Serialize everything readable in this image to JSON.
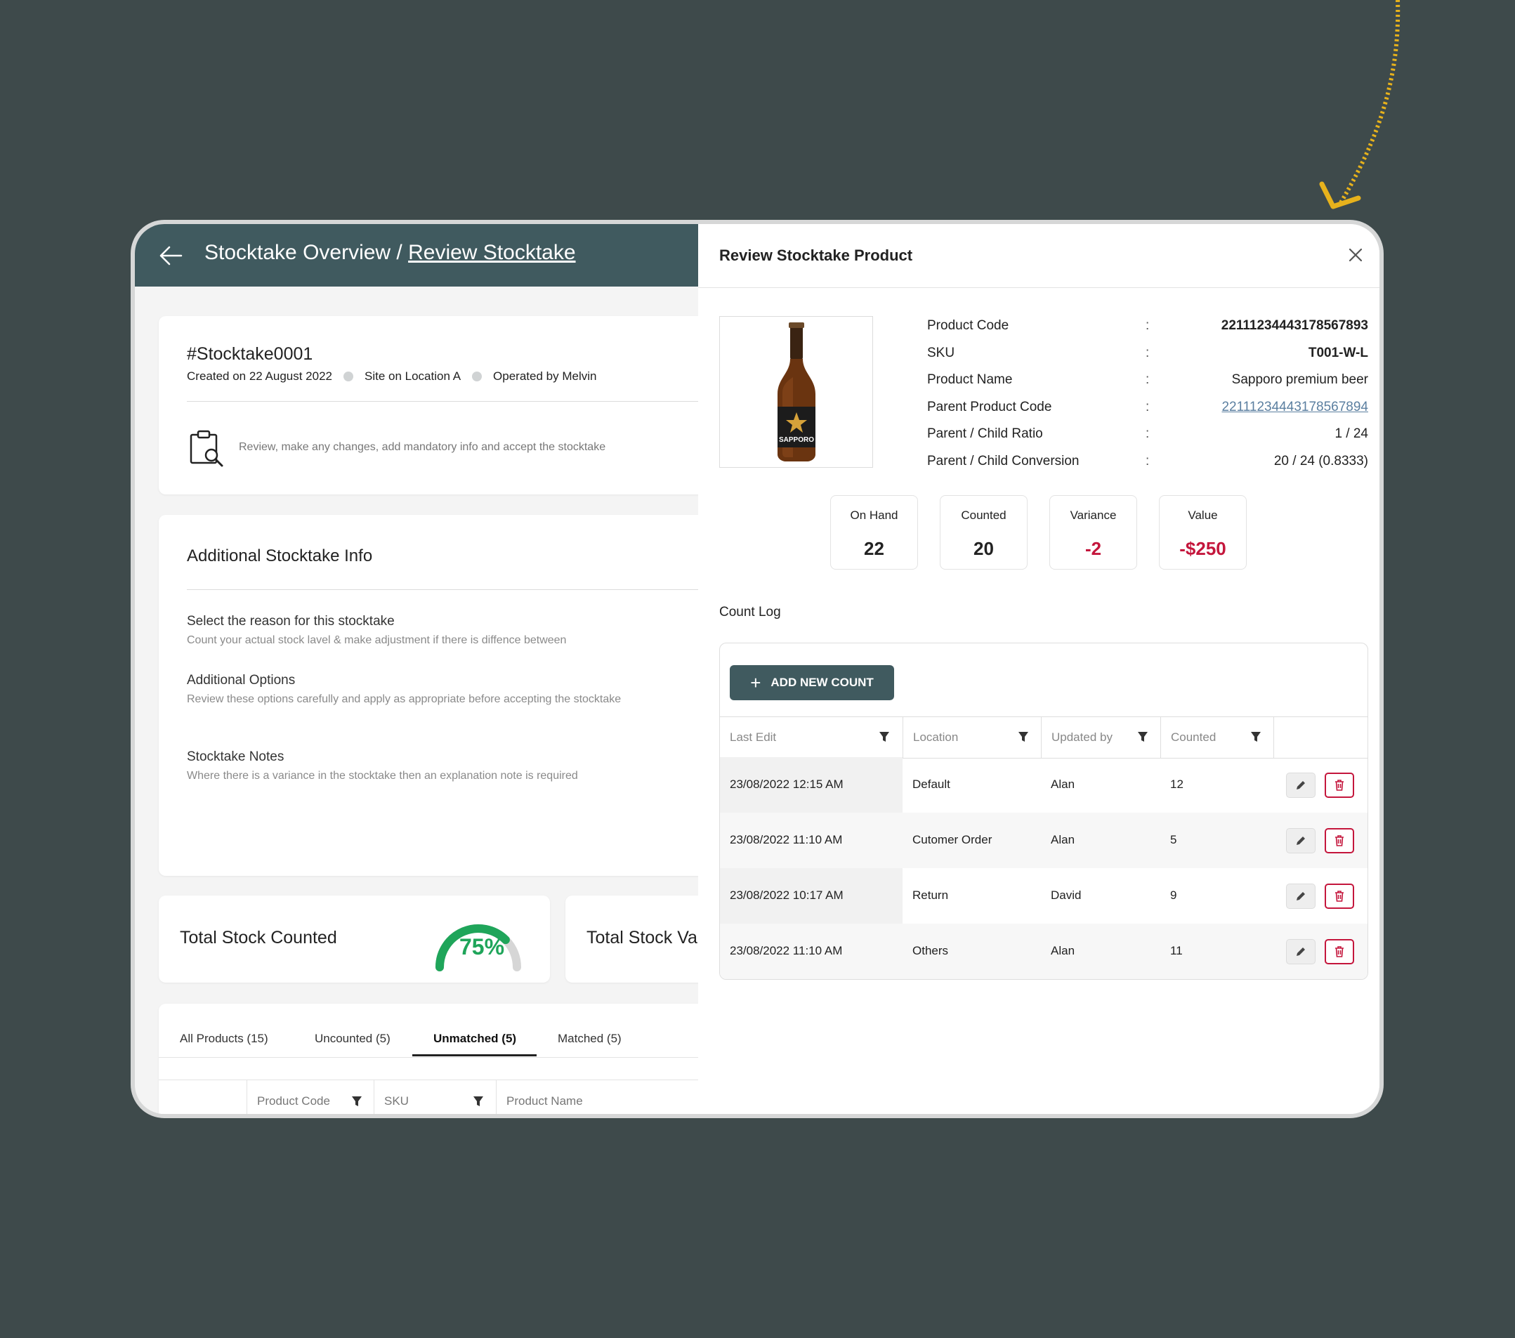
{
  "colors": {
    "background": "#3e4a4b",
    "header": "#405a5f",
    "accent_yellow": "#e7b21c",
    "negative": "#c4163c",
    "gauge_green": "#1fa55a"
  },
  "header": {
    "crumb_root": "Stocktake Overview / ",
    "crumb_current": "Review Stocktake"
  },
  "stocktake": {
    "title": "#Stocktake0001",
    "created": "Created on 22 August 2022",
    "site": "Site on Location A",
    "operator": "Operated by Melvin",
    "hint": "Review, make any changes, add mandatory info and accept the stocktake"
  },
  "additional": {
    "title": "Additional Stocktake Info",
    "reason_title": "Select the reason for this stocktake",
    "reason_desc": "Count your actual stock lavel & make adjustment if there is diffence between",
    "options_title": "Additional Options",
    "options_desc": "Review these options carefully and apply as appropriate before accepting the stocktake",
    "notes_title": "Stocktake Notes",
    "notes_desc": "Where there is a variance in the stocktake then an explanation note is required"
  },
  "totals": {
    "counted_label": "Total Stock Counted",
    "counted_percent_text": "75%",
    "counted_percent": 0.75,
    "value_label": "Total Stock Va"
  },
  "tabs": [
    {
      "label": "All Products (15)"
    },
    {
      "label": "Uncounted (5)"
    },
    {
      "label": "Unmatched (5)",
      "active": true
    },
    {
      "label": "Matched (5)"
    }
  ],
  "products_table": {
    "columns": [
      "Product Code",
      "SKU",
      "Product Name"
    ]
  },
  "drawer": {
    "title": "Review Stocktake Product",
    "image_icon": "beer-bottle-image",
    "info": [
      {
        "label": "Product Code",
        "value": "22111234443178567893"
      },
      {
        "label": "SKU",
        "value": "T001-W-L"
      },
      {
        "label": "Product Name",
        "value": "Sapporo premium beer"
      },
      {
        "label": "Parent Product Code",
        "value": "22111234443178567894"
      },
      {
        "label": "Parent / Child Ratio",
        "value": "1 / 24"
      },
      {
        "label": "Parent / Child Conversion",
        "value": "20 / 24 (0.8333)"
      }
    ],
    "separator": ":",
    "bottle_label": "SAPPORO",
    "stats": [
      {
        "label": "On Hand",
        "value": "22"
      },
      {
        "label": "Counted",
        "value": "20"
      },
      {
        "label": "Variance",
        "value": "-2"
      },
      {
        "label": "Value",
        "value": "-$250"
      }
    ],
    "count_log": {
      "title": "Count Log",
      "add_button": "ADD NEW COUNT",
      "columns": [
        "Last Edit",
        "Location",
        "Updated by",
        "Counted"
      ],
      "rows": [
        {
          "last_edit": "23/08/2022 12:15 AM",
          "location": "Default",
          "updated_by": "Alan",
          "counted": "12"
        },
        {
          "last_edit": "23/08/2022 11:10 AM",
          "location": "Cutomer Order",
          "updated_by": "Alan",
          "counted": "5"
        },
        {
          "last_edit": "23/08/2022 10:17 AM",
          "location": "Return",
          "updated_by": "David",
          "counted": "9"
        },
        {
          "last_edit": "23/08/2022 11:10 AM",
          "location": "Others",
          "updated_by": "Alan",
          "counted": "11"
        }
      ]
    }
  }
}
